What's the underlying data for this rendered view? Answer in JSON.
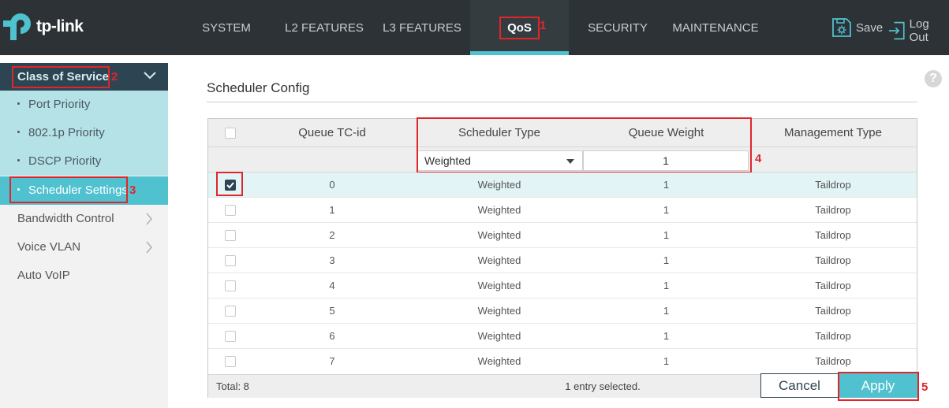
{
  "brand": {
    "name": "tp-link"
  },
  "nav": {
    "items": [
      {
        "label": "SYSTEM"
      },
      {
        "label": "L2 FEATURES"
      },
      {
        "label": "L3 FEATURES"
      },
      {
        "label": "QoS"
      },
      {
        "label": "SECURITY"
      },
      {
        "label": "MAINTENANCE"
      }
    ],
    "active": "QoS",
    "save_label": "Save",
    "logout_label": "Log Out"
  },
  "annotations": [
    "1",
    "2",
    "3",
    "4",
    "5"
  ],
  "sidebar": {
    "group_label": "Class of Service",
    "sub_items": [
      {
        "label": "Port Priority"
      },
      {
        "label": "802.1p Priority"
      },
      {
        "label": "DSCP Priority"
      },
      {
        "label": "Scheduler Settings"
      }
    ],
    "active_sub_item": "Scheduler Settings",
    "items": [
      {
        "label": "Bandwidth Control"
      },
      {
        "label": "Voice VLAN"
      },
      {
        "label": "Auto VoIP"
      }
    ]
  },
  "content": {
    "section_title": "Scheduler Config",
    "help_icon": "?"
  },
  "table": {
    "columns": [
      "Queue TC-id",
      "Scheduler Type",
      "Queue Weight",
      "Management Type"
    ],
    "edit_row": {
      "scheduler_type": "Weighted",
      "queue_weight": "1"
    },
    "rows": [
      {
        "id": "0",
        "type": "Weighted",
        "weight": "1",
        "mgmt": "Taildrop",
        "checked": true
      },
      {
        "id": "1",
        "type": "Weighted",
        "weight": "1",
        "mgmt": "Taildrop",
        "checked": false
      },
      {
        "id": "2",
        "type": "Weighted",
        "weight": "1",
        "mgmt": "Taildrop",
        "checked": false
      },
      {
        "id": "3",
        "type": "Weighted",
        "weight": "1",
        "mgmt": "Taildrop",
        "checked": false
      },
      {
        "id": "4",
        "type": "Weighted",
        "weight": "1",
        "mgmt": "Taildrop",
        "checked": false
      },
      {
        "id": "5",
        "type": "Weighted",
        "weight": "1",
        "mgmt": "Taildrop",
        "checked": false
      },
      {
        "id": "6",
        "type": "Weighted",
        "weight": "1",
        "mgmt": "Taildrop",
        "checked": false
      },
      {
        "id": "7",
        "type": "Weighted",
        "weight": "1",
        "mgmt": "Taildrop",
        "checked": false
      }
    ],
    "footer": {
      "total": "Total: 8",
      "selected": "1 entry selected."
    }
  },
  "buttons": {
    "cancel": "Cancel",
    "apply": "Apply"
  },
  "colors": {
    "header_bg": "#2c3236",
    "accent": "#4fc1cf",
    "dark_teal": "#2d4552",
    "annotation_red": "#e0262b"
  }
}
